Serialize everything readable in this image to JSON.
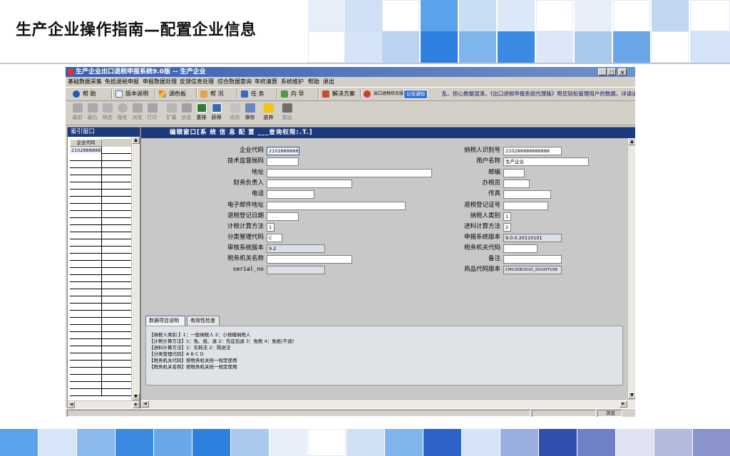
{
  "slide": {
    "title": "生产企业操作指南—配置企业信息"
  },
  "window": {
    "title": "生产企业出口退税申报系统9.0版 -- 生产企业",
    "minimize": "_",
    "maximize": "□",
    "close": "×"
  },
  "menu": [
    "基础数据采集",
    "免抵退税申报",
    "申报数据处理",
    "反馈信息处理",
    "综合数据查询",
    "年终清算",
    "系统维护",
    "帮助",
    "退出"
  ],
  "toolbar1": {
    "help": "帮 助",
    "version": "版本说明",
    "color": "调色板",
    "status": "帮 况",
    "task": "任 务",
    "wizard": "向 导",
    "solution": "解决方案",
    "portal": "出口退税综合服务",
    "notice_badge": "公告通知",
    "marquee": "乱、担心数据混淆，《出口退税申报系统代理版》帮您轻松管理用户的数据，详请请参!"
  },
  "toolbar2": [
    {
      "label": "最前",
      "icon": "first-icon"
    },
    {
      "label": "最后",
      "icon": "last-icon"
    },
    {
      "label": "筛选",
      "icon": "filter-icon"
    },
    {
      "label": "搜索",
      "icon": "search-icon"
    },
    {
      "label": "浏览",
      "icon": "browse-icon"
    },
    {
      "label": "打印",
      "icon": "print-icon"
    },
    {
      "label": "扩展",
      "icon": "expand-icon"
    },
    {
      "label": "状态",
      "icon": "state-icon"
    },
    {
      "label": "重排",
      "icon": "reorder-icon"
    },
    {
      "label": "获得",
      "icon": "fetch-icon"
    },
    {
      "label": "修改",
      "icon": "edit-icon"
    },
    {
      "label": "保存",
      "icon": "save-icon"
    },
    {
      "label": "放弃",
      "icon": "warning-icon"
    },
    {
      "label": "退出",
      "icon": "exit-icon"
    }
  ],
  "index_panel": {
    "title": "索引窗口",
    "column_header": "企业代码",
    "rows": [
      "2102888888"
    ]
  },
  "edit_panel": {
    "title": "编辑窗口[系 统 信 息 配 置 ___查询权限:.T.]",
    "left_fields": [
      {
        "label": "企业代码",
        "value": "2102888888"
      },
      {
        "label": "技术监督局码",
        "value": ""
      },
      {
        "label": "地址",
        "value": ""
      },
      {
        "label": "财务负责人",
        "value": ""
      },
      {
        "label": "电话",
        "value": ""
      },
      {
        "label": "电子邮件地址",
        "value": ""
      },
      {
        "label": "退税登记日期",
        "value": "  .  .  "
      },
      {
        "label": "计税计算方法",
        "value": "1"
      },
      {
        "label": "分类管理代码",
        "value": "C"
      },
      {
        "label": "审核系统版本",
        "value": "9.2"
      },
      {
        "label": "税务机关名称",
        "value": ""
      },
      {
        "label": "serial_no",
        "value": ""
      }
    ],
    "right_fields": [
      {
        "label": "纳税人识别号",
        "value": "210288888888888"
      },
      {
        "label": "用户名称",
        "value": "生产企业"
      },
      {
        "label": "邮编",
        "value": ""
      },
      {
        "label": "办税员",
        "value": ""
      },
      {
        "label": "传真",
        "value": ""
      },
      {
        "label": "退税登记证号",
        "value": ""
      },
      {
        "label": "纳税人类别",
        "value": "1"
      },
      {
        "label": "进料计算方法",
        "value": "2"
      },
      {
        "label": "申报系统版本",
        "value": "9.0.0.20110101"
      },
      {
        "label": "税务机关代码",
        "value": ""
      },
      {
        "label": "备注",
        "value": ""
      },
      {
        "label": "商品代码版本",
        "value": "CMCODE2010_20100T15B"
      }
    ],
    "tabs": [
      "数据项目说明",
      "有效性检查"
    ],
    "info_lines": [
      "【纳税人类别 】1：一般纳税人    2：小规模纳税人",
      "【计税计算方法】1：免、抵、退    2：先征后退    3：免税    4：免抵(不退)",
      "【进料计算方法】1：实耗法    2：购进法",
      "【分类管理代码】A  B  C  D",
      "【税务机关代码】按税务机关统一规定使用",
      "【税务机关名称】按税务机关统一规定使用"
    ]
  },
  "statusbar": {
    "mode": "浏览"
  },
  "colors": {
    "title_blue": "#1c3a7e",
    "window_gray": "#d4d0c8"
  }
}
